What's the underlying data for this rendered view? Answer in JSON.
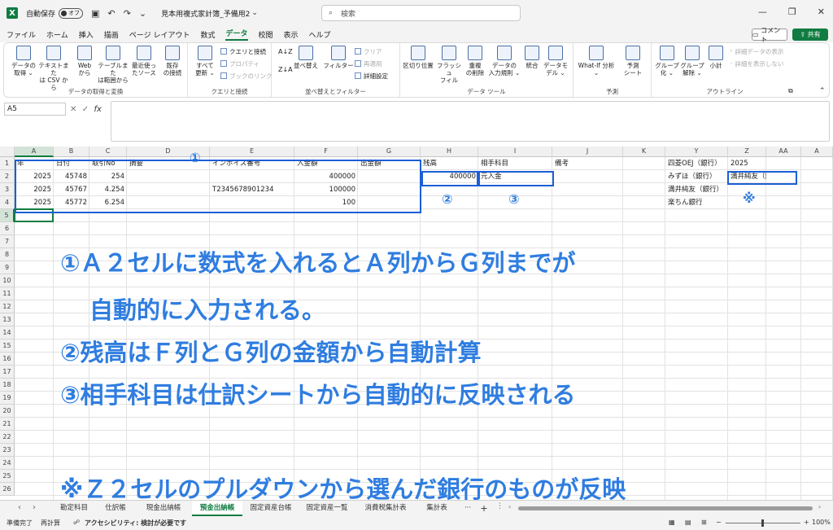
{
  "titlebar": {
    "app_icon": "X",
    "autosave_label": "自動保存",
    "autosave_state": "オフ",
    "doc_title": "見本用複式家計簿_予備用2",
    "search_placeholder": "検索"
  },
  "menu": {
    "items": [
      "ファイル",
      "ホーム",
      "挿入",
      "描画",
      "ページ レイアウト",
      "数式",
      "データ",
      "校閲",
      "表示",
      "ヘルプ"
    ],
    "active": "データ",
    "comment_label": "コメント",
    "share_label": "共有"
  },
  "ribbon": {
    "groups": [
      {
        "label": "データの取得と変換"
      },
      {
        "label": "クエリと接続"
      },
      {
        "label": "並べ替えとフィルター"
      },
      {
        "label": "データ ツール"
      },
      {
        "label": "予測"
      },
      {
        "label": "アウトライン"
      }
    ],
    "get_data": [
      "データの\n取得 ⌄",
      "テキストまた\nは CSV から",
      "Web\nから",
      "テーブルまた\nは範囲から",
      "最近使っ\nたソース",
      "既存\nの接続"
    ],
    "refresh": "すべて\n更新 ⌄",
    "queries": [
      "クエリと接続",
      "プロパティ",
      "ブックのリンク"
    ],
    "sort": [
      "並べ替え",
      "フィルター"
    ],
    "filter_small": [
      "クリア",
      "再適用",
      "詳細設定"
    ],
    "tools": [
      "区切り位置",
      "フラッシュ\nフィル",
      "重複\nの削除",
      "データの\n入力規則 ⌄",
      "統合",
      "データモ\nデル ⌄"
    ],
    "forecast": [
      "What-If 分析\n⌄",
      "予測\nシート"
    ],
    "outline": [
      "グループ\n化 ⌄",
      "グループ\n解除 ⌄",
      "小計"
    ],
    "outline_small": [
      "詳細データの表示",
      "詳細を表示しない"
    ]
  },
  "formula_bar": {
    "name_box": "A5",
    "cancel": "✕",
    "enter": "✓",
    "fx": "fx",
    "content": ""
  },
  "grid": {
    "columns": [
      "A",
      "B",
      "C",
      "D",
      "E",
      "F",
      "G",
      "H",
      "I",
      "J",
      "K",
      "Y",
      "Z",
      "AA",
      "A"
    ],
    "rows": [
      "1",
      "2",
      "3",
      "4",
      "5",
      "6",
      "7",
      "8",
      "9",
      "10",
      "11",
      "12",
      "13",
      "14",
      "15",
      "16",
      "17",
      "18",
      "19",
      "20",
      "21",
      "22",
      "23",
      "24",
      "25",
      "26"
    ],
    "header_row": {
      "A": "年",
      "B": "日付",
      "C": "取引No",
      "D": "摘要",
      "E": "インボイス番号",
      "F": "入金額",
      "G": "出金額",
      "H": "残高",
      "I": "相手科目",
      "J": "備考",
      "Y": "四菱OEJ（銀行）",
      "Z": "2025"
    },
    "data_rows": [
      {
        "A": "2025",
        "B": "45748",
        "C": "254",
        "E": "",
        "F": "400000",
        "H": "400000",
        "I": "元入金",
        "Y": "みずほ（銀行）",
        "Z": "満井純友（銀行）"
      },
      {
        "A": "2025",
        "B": "45767",
        "C": "4.254",
        "E": "T2345678901234",
        "F": "100000",
        "Y": "満井純友（銀行）"
      },
      {
        "A": "2025",
        "B": "45772",
        "C": "6.254",
        "E": "",
        "F": "100",
        "Y": "楽ちん銀行"
      }
    ]
  },
  "annotations": {
    "marker_1": "①",
    "marker_2": "②",
    "marker_3": "③",
    "marker_note": "※",
    "line1": "①Ａ２セルに数式を入れるとＡ列からＧ列までが",
    "line2": "自動的に入力される。",
    "line3": "②残高はＦ列とＧ列の金額から自動計算",
    "line4": "③相手科目は仕訳シートから自動的に反映される",
    "line5": "※Ｚ２セルのプルダウンから選んだ銀行のものが反映",
    "color": "#2f7de0",
    "box_color": "#1b5fd6"
  },
  "sheet_tabs": {
    "tabs": [
      "勘定科目",
      "仕訳帳",
      "現金出納帳",
      "預金出納帳",
      "固定資産台帳",
      "固定資産一覧",
      "消費税集計表",
      "集計表"
    ],
    "active": "預金出納帳",
    "more": "···",
    "add": "+"
  },
  "status": {
    "ready": "準備完了",
    "recalc": "再計算",
    "accessibility": "アクセシビリティ: 検討が必要です",
    "zoom": "100%"
  }
}
